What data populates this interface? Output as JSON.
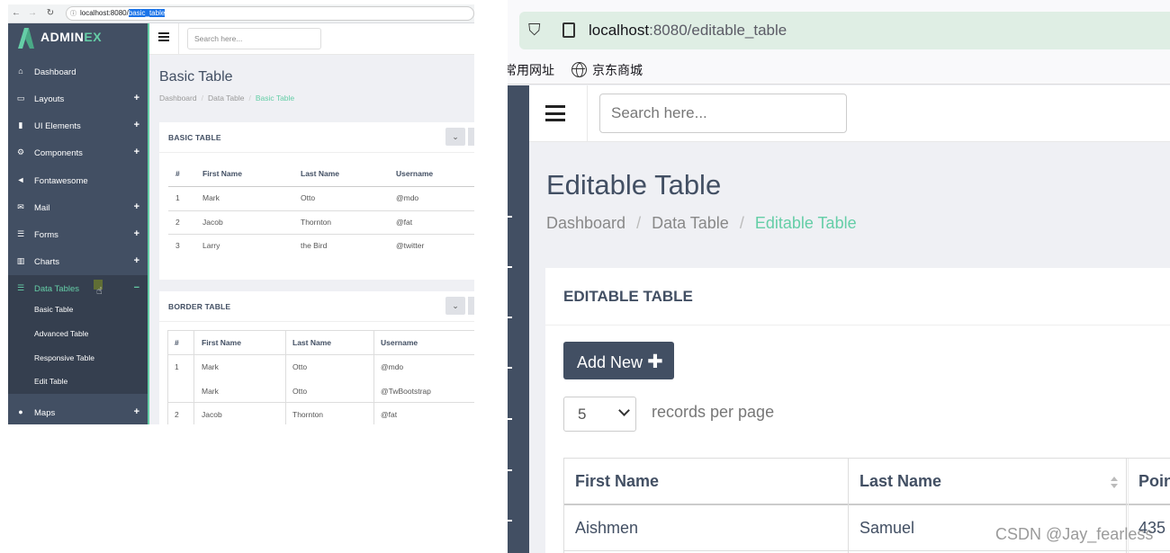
{
  "left": {
    "browser": {
      "url_host": "localhost:8080/",
      "url_path": "basic_table"
    },
    "brand": {
      "main": "ADMIN",
      "accent": "EX"
    },
    "sidebar": {
      "items": [
        {
          "label": "Dashboard",
          "icon": "home-icon",
          "expand": ""
        },
        {
          "label": "Layouts",
          "icon": "laptop-icon",
          "expand": "+"
        },
        {
          "label": "UI Elements",
          "icon": "book-icon",
          "expand": "+"
        },
        {
          "label": "Components",
          "icon": "cogs-icon",
          "expand": "+"
        },
        {
          "label": "Fontawesome",
          "icon": "bullhorn-icon",
          "expand": ""
        },
        {
          "label": "Mail",
          "icon": "envelope-icon",
          "expand": "+"
        },
        {
          "label": "Forms",
          "icon": "tasks-icon",
          "expand": "+"
        },
        {
          "label": "Charts",
          "icon": "bar-chart-icon",
          "expand": "+"
        },
        {
          "label": "Data Tables",
          "icon": "list-icon",
          "expand": "−"
        },
        {
          "label": "Maps",
          "icon": "map-marker-icon",
          "expand": "+"
        }
      ],
      "submenu": [
        "Basic Table",
        "Advanced Table",
        "Responsive Table",
        "Edit Table"
      ]
    },
    "header": {
      "search_placeholder": "Search here..."
    },
    "page_title": "Basic Table",
    "breadcrumb": [
      "Dashboard",
      "Data Table",
      "Basic Table"
    ],
    "basic_table": {
      "title": "BASIC TABLE",
      "columns": [
        "#",
        "First Name",
        "Last Name",
        "Username"
      ],
      "rows": [
        [
          "1",
          "Mark",
          "Otto",
          "@mdo"
        ],
        [
          "2",
          "Jacob",
          "Thornton",
          "@fat"
        ],
        [
          "3",
          "Larry",
          "the Bird",
          "@twitter"
        ]
      ]
    },
    "border_table": {
      "title": "BORDER TABLE",
      "columns": [
        "#",
        "First Name",
        "Last Name",
        "Username"
      ],
      "rows": [
        [
          "1",
          "Mark",
          "Otto",
          "@mdo"
        ],
        [
          "",
          "Mark",
          "Otto",
          "@TwBootstrap"
        ],
        [
          "2",
          "Jacob",
          "Thornton",
          "@fat"
        ]
      ]
    }
  },
  "right": {
    "browser": {
      "url_host": "localhost",
      "url_rest": ":8080/editable_table"
    },
    "bookmarks": [
      "常用网址",
      "京东商城"
    ],
    "header": {
      "search_placeholder": "Search here..."
    },
    "page_title": "Editable Table",
    "breadcrumb": [
      "Dashboard",
      "Data Table",
      "Editable Table"
    ],
    "panel_title": "EDITABLE TABLE",
    "add_button": "Add New",
    "records_select": "5",
    "records_label": "records per page",
    "table": {
      "columns": [
        "First Name",
        "Last Name",
        "Poin"
      ],
      "rows": [
        [
          "Aishmen",
          "Samuel",
          "435"
        ]
      ]
    }
  },
  "watermark": "CSDN @Jay_fearless",
  "colors": {
    "sidebar": "#424f63",
    "accent": "#65cea7",
    "page_bg": "#eff0f4"
  }
}
